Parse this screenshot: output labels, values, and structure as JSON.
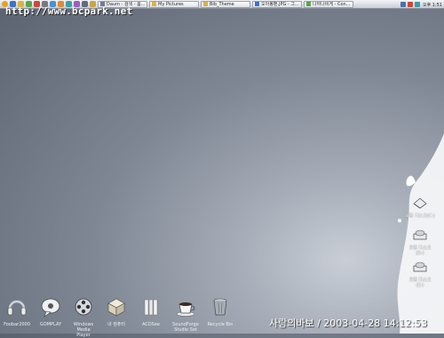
{
  "taskbar": {
    "tasks": [
      {
        "label": "Daum - 검색 - 봄..."
      },
      {
        "label": "My Pictures"
      },
      {
        "label": "Bib_Theme"
      },
      {
        "label": "오아봉팬.JPG - 그..."
      },
      {
        "label": "나하나비게 - Con..."
      }
    ],
    "clock": "오후 1:51"
  },
  "desktop": {
    "url_text": "http://www.bcpark.net",
    "signature": "사랑의바보 / 2003-04-28 14:12:53",
    "drives": [
      {
        "label": "로컬 디스크(C:)"
      },
      {
        "label": "로컬 디스크(D:)"
      },
      {
        "label": "로컬 디스크\n(E:)"
      }
    ],
    "dock": [
      {
        "label": "Foobar2000"
      },
      {
        "label": "GOMPLAY"
      },
      {
        "label": "Windows Media\nPlayer"
      },
      {
        "label": "내 컴퓨터"
      },
      {
        "label": "ACDSee"
      },
      {
        "label": "SoundForge\nStudio Set"
      },
      {
        "label": "Recycle Bin"
      }
    ]
  }
}
